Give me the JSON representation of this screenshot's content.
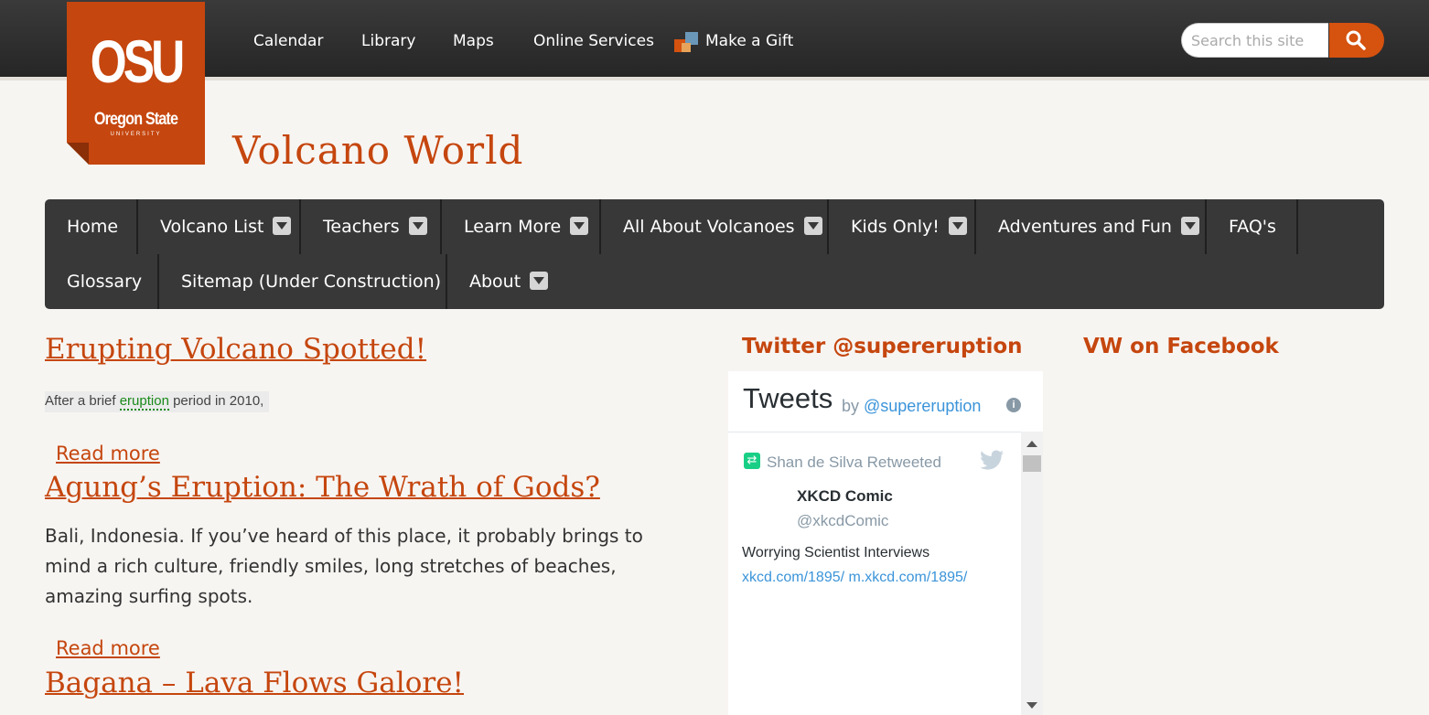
{
  "topnav": {
    "links": [
      "Calendar",
      "Library",
      "Maps",
      "Online Services"
    ],
    "gift": "Make a Gift"
  },
  "logo": {
    "big": "OSU",
    "sub": "Oregon State",
    "uni": "UNIVERSITY"
  },
  "search": {
    "placeholder": "Search this site"
  },
  "site_title": "Volcano World",
  "mainnav": {
    "items": [
      {
        "label": "Home"
      },
      {
        "label": "Volcano List"
      },
      {
        "label": "Teachers"
      },
      {
        "label": "Learn More"
      },
      {
        "label": "All About Volcanoes"
      },
      {
        "label": "Kids Only!"
      },
      {
        "label": "Adventures and Fun"
      },
      {
        "label": "FAQ's"
      },
      {
        "label": "Glossary"
      },
      {
        "label": "Sitemap (Under Construction)"
      },
      {
        "label": "About"
      }
    ]
  },
  "articles": [
    {
      "title": "Erupting Volcano Spotted!",
      "snippet_a": "After a brief ",
      "snippet_kw": "eruption",
      "snippet_b": " period in 2010,",
      "read_more": "Read more"
    },
    {
      "title": "Agung’s Eruption: The Wrath of Gods?",
      "body": "Bali, Indonesia. If you’ve heard of this place, it probably brings to mind a rich culture, friendly smiles, long stretches of beaches, amazing surfing spots.",
      "read_more": "Read more"
    },
    {
      "title": "Bagana – Lava Flows Galore!"
    }
  ],
  "twitter": {
    "heading": "Twitter @supereruption",
    "widget_title": "Tweets",
    "by": "by ",
    "by_handle": "@supereruption",
    "retweeted": "Shan de Silva Retweeted",
    "name": "XKCD Comic",
    "handle": "@xkcdComic",
    "text": "Worrying Scientist Interviews",
    "link1": "xkcd.com/1895/",
    "link2": "m.xkcd.com/1895/"
  },
  "facebook": {
    "heading": "VW on Facebook"
  },
  "colors": {
    "accent": "#c5460e",
    "nav_bg": "#383838",
    "topbar_bg": "#2d2d2d",
    "search_button": "#d5520f"
  }
}
